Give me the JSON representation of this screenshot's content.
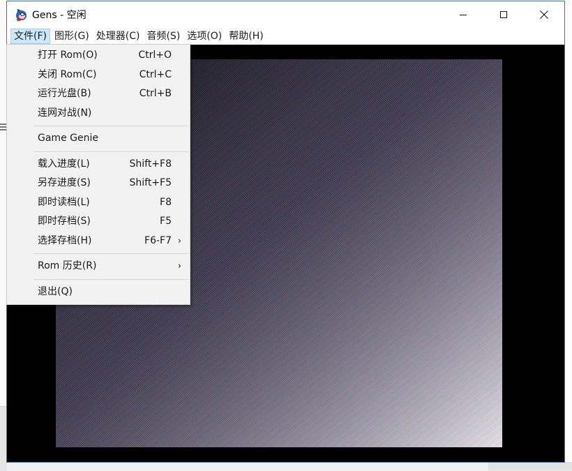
{
  "window": {
    "title": "Gens - 空闲"
  },
  "menubar": {
    "items": [
      "文件(F)",
      "图形(G)",
      "处理器(C)",
      "音频(S)",
      "选项(O)",
      "帮助(H)"
    ]
  },
  "file_menu": {
    "group1": [
      {
        "label": "打开 Rom(O)",
        "accel": "Ctrl+O"
      },
      {
        "label": "关闭 Rom(C)",
        "accel": "Ctrl+C"
      },
      {
        "label": "运行光盘(B)",
        "accel": "Ctrl+B"
      },
      {
        "label": "连网对战(N)",
        "accel": ""
      }
    ],
    "game_genie": "Game Genie",
    "group3": [
      {
        "label": "载入进度(L)",
        "accel": "Shift+F8"
      },
      {
        "label": "另存进度(S)",
        "accel": "Shift+F5"
      },
      {
        "label": "即时读档(L)",
        "accel": "F8"
      },
      {
        "label": "即时存档(S)",
        "accel": "F5"
      },
      {
        "label": "选择存档(H)",
        "accel": "F6-F7"
      }
    ],
    "rom_history": "Rom 历史(R)",
    "exit": "退出(Q)"
  },
  "icons": {
    "app": "gens-sonic-icon",
    "minimize": "minimize-icon",
    "maximize": "maximize-icon",
    "close": "close-icon",
    "submenu": "chevron-right-icon"
  },
  "colors": {
    "window_border": "#2b79d0",
    "menu_highlight": "#cce8ff",
    "screen_bg": "#000000"
  }
}
